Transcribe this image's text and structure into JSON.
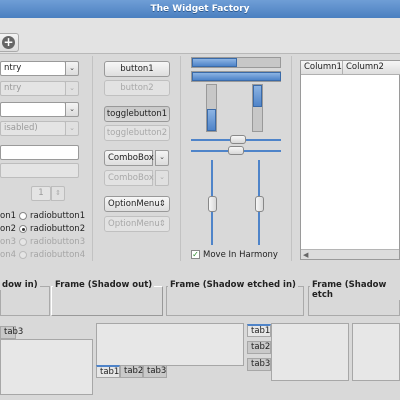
{
  "window": {
    "title": "The Widget Factory"
  },
  "toolbar": {
    "add_icon": "plus-circle-icon",
    "add_glyph": "+"
  },
  "left_column": {
    "entry_value": "ntry",
    "entry_disabled_value": "ntry",
    "combo_disabled_value": "isabled)",
    "spin_value": "1",
    "radios_col1": [
      {
        "label": "on1",
        "selected": false,
        "disabled": false
      },
      {
        "label": "on2",
        "selected": false,
        "disabled": false
      },
      {
        "label": "on3",
        "selected": false,
        "disabled": true
      },
      {
        "label": "on4",
        "selected": false,
        "disabled": true
      }
    ],
    "radios_col2": [
      {
        "label": "radiobutton1",
        "selected": false,
        "disabled": false
      },
      {
        "label": "radiobutton2",
        "selected": true,
        "disabled": false
      },
      {
        "label": "radiobutton3",
        "selected": false,
        "disabled": true
      },
      {
        "label": "radiobutton4",
        "selected": false,
        "disabled": true
      }
    ]
  },
  "buttons": {
    "button1": "button1",
    "button2": "button2",
    "togglebutton1": "togglebutton1",
    "togglebutton2": "togglebutton2",
    "combobox": "ComboBox",
    "combobox_disabled": "ComboBox",
    "optionmenu": "OptionMenu",
    "optionmenu_disabled": "OptionMenu",
    "arrow_down": "⌄",
    "arrow_updown": "⇕"
  },
  "sliders": {
    "move_in_harmony": "Move In Harmony",
    "move_in_harmony_checked": true,
    "check_glyph": "✓"
  },
  "tree": {
    "columns": [
      "Column1",
      "Column2"
    ]
  },
  "frames": [
    "dow in)",
    "Frame (Shadow out)",
    "Frame (Shadow etched in)",
    "Frame (Shadow etch"
  ],
  "notebooks": {
    "nb1_tabs": [
      "tab3"
    ],
    "nb2_tabs": [
      "tab1",
      "tab2",
      "tab3"
    ],
    "nb3_tabs": [
      "tab1",
      "tab2",
      "tab3"
    ]
  },
  "colors": {
    "accent": "#4f84c9",
    "titlebar": "#5a8fce",
    "background": "#d9d9d9"
  }
}
